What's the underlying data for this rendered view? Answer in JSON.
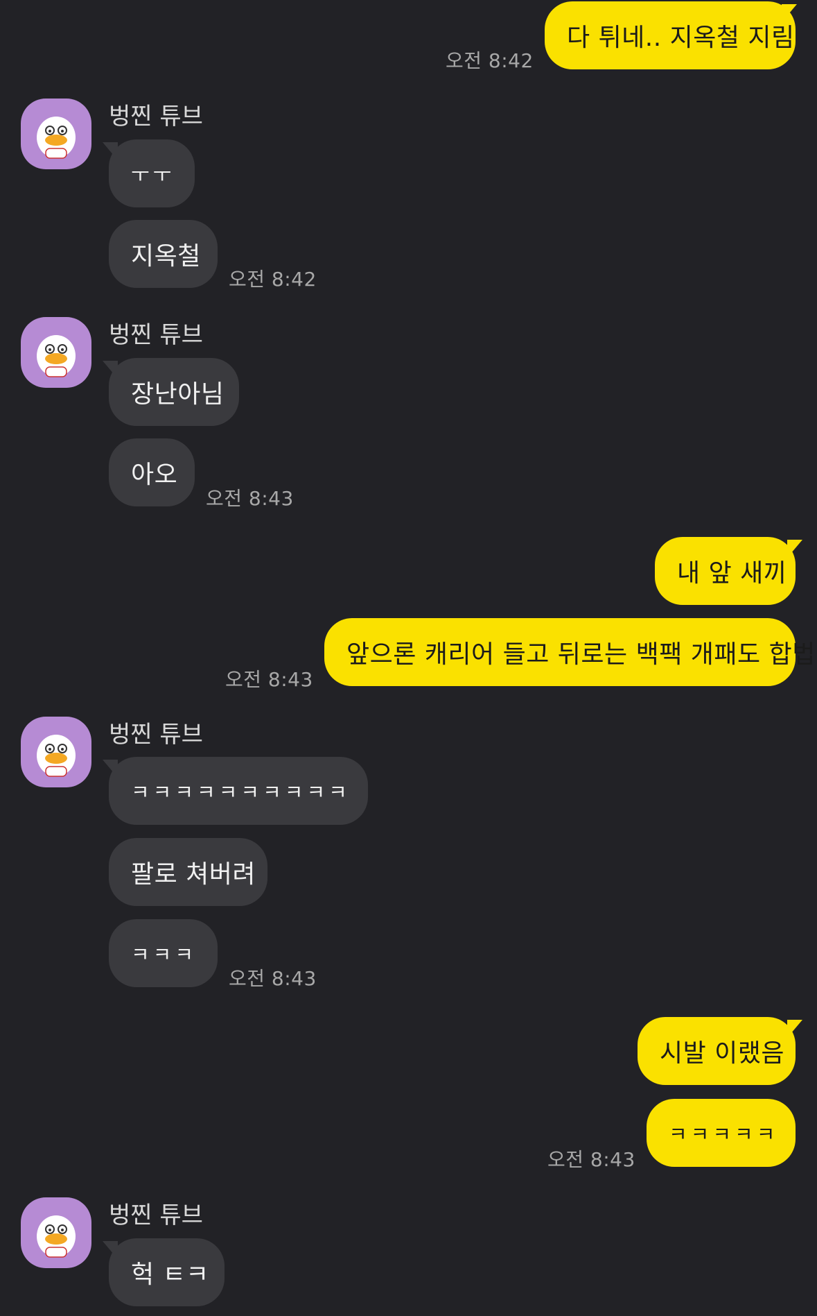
{
  "sender_name": "벙찐 튜브",
  "messages": {
    "m1": "다 튀네.. 지옥철 지림",
    "m2": "ㅜㅜ",
    "m3": "지옥철",
    "m4": "장난아님",
    "m5": "아오",
    "m6": "내 앞 새끼",
    "m7": "앞으론 캐리어 들고 뒤로는 백팩 개패도 합법",
    "m8": "ㅋㅋㅋㅋㅋㅋㅋㅋㅋㅋ",
    "m9": "팔로 쳐버려",
    "m10": "ㅋㅋㅋ",
    "m11": "시발 이랬음",
    "m12": "ㅋㅋㅋㅋㅋ",
    "m13": "헉 ㅌㅋ"
  },
  "times": {
    "t1": "오전 8:42",
    "t2": "오전 8:42",
    "t3": "오전 8:43",
    "t4": "오전 8:43",
    "t5": "오전 8:43",
    "t6": "오전 8:43"
  },
  "colors": {
    "background": "#222226",
    "incoming_bubble": "#3a3a3e",
    "outgoing_bubble": "#fae100",
    "avatar_bg": "#b68bd4"
  },
  "icons": {
    "avatar": "duck-character-avatar"
  }
}
